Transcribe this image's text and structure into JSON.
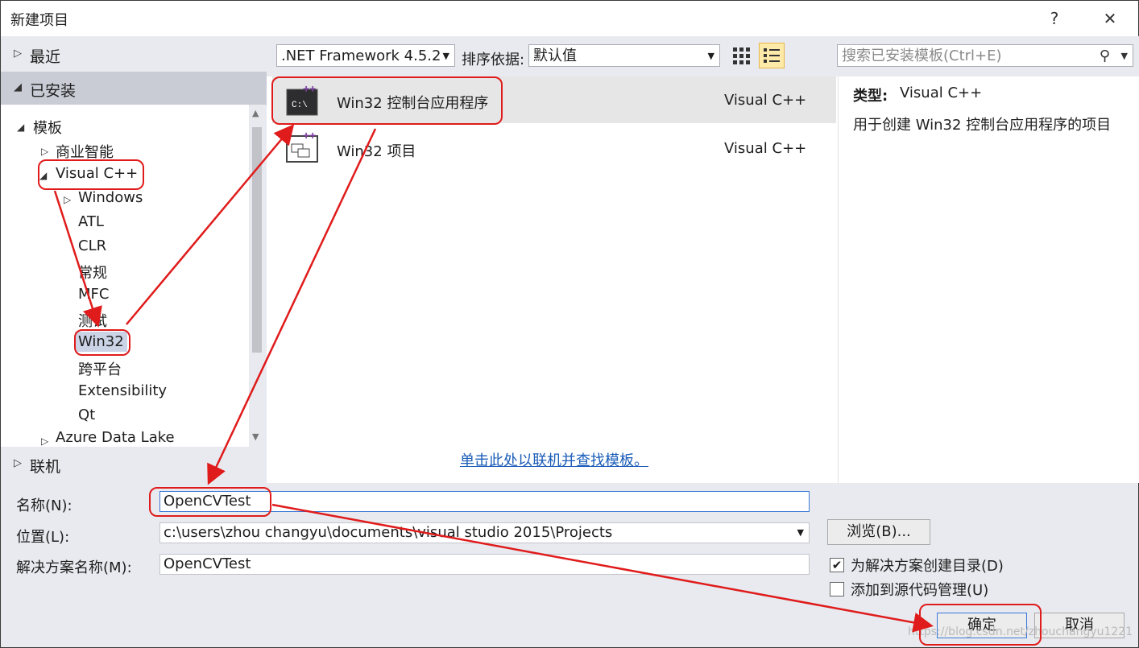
{
  "window": {
    "title": "新建项目",
    "help_label": "?",
    "close_label": "✕"
  },
  "left_nav": {
    "recent_label": "最近",
    "installed_label": "已安装",
    "online_label": "联机",
    "tree": {
      "templates": "模板",
      "bi": "商业智能",
      "vcpp": "Visual C++",
      "windows": "Windows",
      "atl": "ATL",
      "clr": "CLR",
      "general": "常规",
      "mfc": "MFC",
      "test": "测试",
      "win32": "Win32",
      "crossplatform": "跨平台",
      "extensibility": "Extensibility",
      "qt": "Qt",
      "azure": "Azure Data Lake"
    }
  },
  "toolbar": {
    "framework_value": ".NET Framework 4.5.2",
    "sort_label": "排序依据:",
    "sort_value": "默认值",
    "search_placeholder": "搜索已安装模板(Ctrl+E)"
  },
  "templates": [
    {
      "name": "Win32 控制台应用程序",
      "lang": "Visual C++",
      "icon": "console-app-icon"
    },
    {
      "name": "Win32 项目",
      "lang": "Visual C++",
      "icon": "win32-project-icon"
    }
  ],
  "online_link": "单击此处以联机并查找模板。",
  "details": {
    "type_label": "类型:",
    "type_value": "Visual C++",
    "description": "用于创建 Win32 控制台应用程序的项目"
  },
  "form": {
    "name_label": "名称(N):",
    "name_value": "OpenCVTest",
    "location_label": "位置(L):",
    "location_value": "c:\\users\\zhou changyu\\documents\\visual studio 2015\\Projects",
    "solution_label": "解决方案名称(M):",
    "solution_value": "OpenCVTest",
    "browse_label": "浏览(B)...",
    "create_dir_label": "为解决方案创建目录(D)",
    "create_dir_checked": true,
    "source_control_label": "添加到源代码管理(U)",
    "source_control_checked": false,
    "ok_label": "确定",
    "cancel_label": "取消"
  },
  "watermark": "https://blog.csdn.net/zhouchangyu1221",
  "colors": {
    "annotation_red": "#e01b1b",
    "panel_bg": "#e8eaef",
    "link_blue": "#1a5cb8",
    "selected_row": "#e6e6e6",
    "focus_border": "#3b78d8"
  }
}
